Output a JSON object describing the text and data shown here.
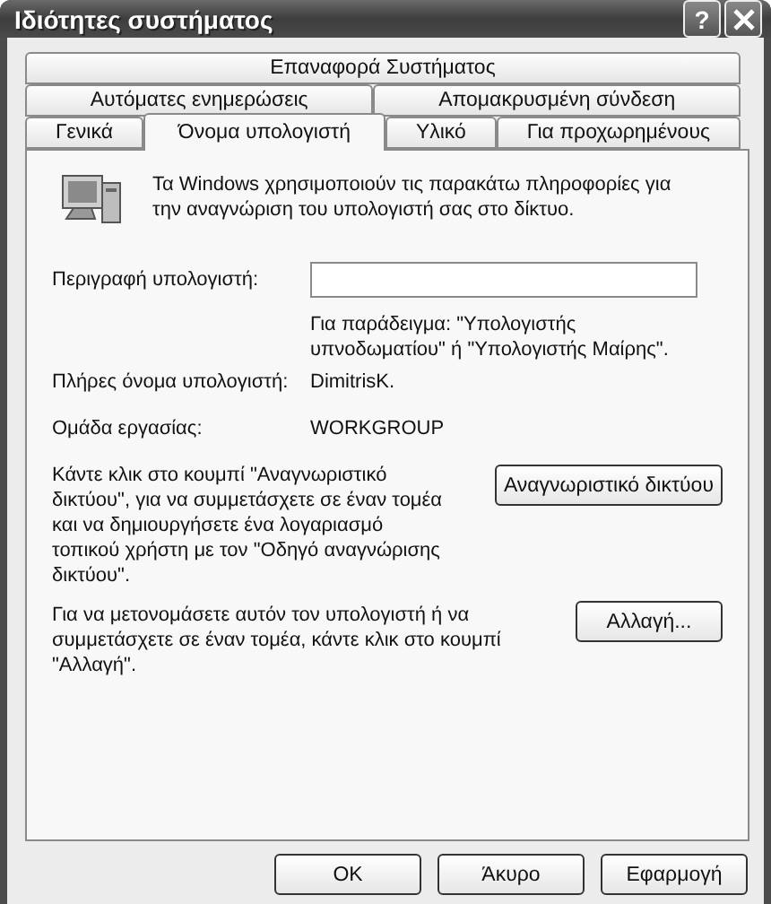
{
  "window": {
    "title": "Ιδιότητες συστήματος",
    "title_buttons": [
      "?"
    ]
  },
  "tab_rows": [
    [
      {
        "label": "Επαναφορά Συστήματος",
        "selected": false
      }
    ],
    [
      {
        "label": "Αυτόματες ενημερώσεις",
        "selected": false
      },
      {
        "label": "Απομακρυσμένη σύνδεση",
        "selected": false
      }
    ],
    [
      {
        "label": "Γενικά",
        "selected": false
      },
      {
        "label": "Όνομα υπολογιστή",
        "selected": true
      },
      {
        "label": "Υλικό",
        "selected": false
      },
      {
        "label": "Για προχωρημένους",
        "selected": false
      }
    ]
  ],
  "intro": "Τα Windows χρησιμοποιούν τις παρακάτω πληροφορίες για την αναγνώριση του υπολογιστή σας στο δίκτυο.",
  "description": {
    "label": "Περιγραφή υπολογιστή:",
    "hint": "Για παράδειγμα: \"Υπολογιστής υπνοδωματίου\" ή \"Υπολογιστής Μαίρης\"."
  },
  "full_name": {
    "label": "Πλήρες όνομα υπολογιστή:",
    "value": "DimitrisK."
  },
  "workgroup": {
    "label": "Ομάδα εργασίας:",
    "value": "WORKGROUP"
  },
  "actions": [
    {
      "text": "Κάντε κλικ στο κουμπί \"Αναγνωριστικό δικτύου\", για να συμμετάσχετε σε έναν τομέα και να δημιουργήσετε ένα λογαριασμό τοπικού χρήστη με τον \"Οδηγό αναγνώρισης δικτύου\".",
      "button": "Αναγνωριστικό δικτύου"
    },
    {
      "text": "Για να μετονομάσετε αυτόν τον υπολογιστή ή να συμμετάσχετε σε έναν τομέα, κάντε κλικ στο κουμπί \"Αλλαγή\".",
      "button": "Αλλαγή..."
    }
  ],
  "buttons": [
    "OK",
    "Άκυρο",
    "Εφαρμογή"
  ]
}
